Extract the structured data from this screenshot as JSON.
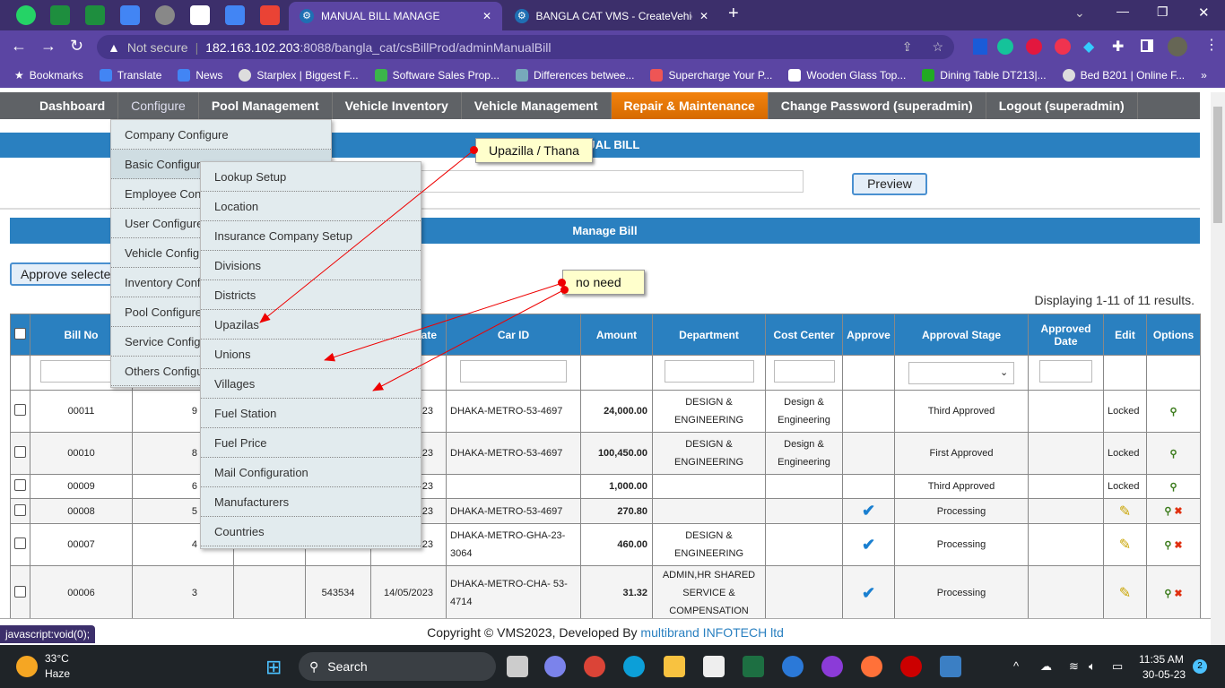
{
  "browser": {
    "tabs": [
      {
        "title": "MANUAL BILL MANAGE",
        "active": true
      },
      {
        "title": "BANGLA CAT VMS - CreateVehicl"
      }
    ],
    "security": "Not secure",
    "url_host": "182.163.102.203",
    "url_path": ":8088/bangla_cat/csBillProd/adminManualBill",
    "bookmarks": [
      "Bookmarks",
      "Translate",
      "News",
      "Starplex | Biggest F...",
      "Software Sales Prop...",
      "Differences betwee...",
      "Supercharge Your P...",
      "Wooden Glass Top...",
      "Dining Table DT213|...",
      "Bed B201 | Online F..."
    ],
    "status_url": "javascript:void(0);"
  },
  "nav": [
    "Dashboard",
    "Configure",
    "Pool Management",
    "Vehicle Inventory",
    "Vehicle Management",
    "Repair & Maintenance",
    "Change Password (superadmin)",
    "Logout (superadmin)"
  ],
  "configure_menu": [
    "Company Configure",
    "Basic Configure",
    "Employee Configure",
    "User Configure",
    "Vehicle Configure",
    "Inventory Configure",
    "Pool Configure",
    "Service Configure",
    "Others Configure"
  ],
  "basic_submenu": [
    "Lookup Setup",
    "Location",
    "Insurance Company Setup",
    "Divisions",
    "Districts",
    "Upazilas",
    "Unions",
    "Villages",
    "Fuel Station",
    "Fuel Price",
    "Mail Configuration",
    "Manufacturers",
    "Countries"
  ],
  "page": {
    "title": "MANUAL BILL",
    "preview": "Preview",
    "section": "Manage Bill",
    "approve_selected": "Approve selected",
    "displaying": "Displaying 1-11 of 11 results."
  },
  "notes": {
    "upazilla": "Upazilla / Thana",
    "no_need": "no need"
  },
  "table": {
    "headers": [
      "Bill No",
      "",
      "",
      "",
      "Date",
      "Car ID",
      "Amount",
      "Department",
      "Cost Center",
      "Approve",
      "Approval Stage",
      "Approved Date",
      "Edit",
      "Options"
    ],
    "rows": [
      {
        "bill": "00011",
        "c2": "9",
        "c4": "",
        "date": "23",
        "car": "DHAKA-METRO-53-4697",
        "amount": "24,000.00",
        "dept": "DESIGN & ENGINEERING",
        "cost": "Design & Engineering",
        "approve": false,
        "stage": "Third Approved",
        "edit": "Locked",
        "delete": false
      },
      {
        "bill": "00010",
        "c2": "8",
        "c4": "",
        "date": "23",
        "car": "DHAKA-METRO-53-4697",
        "amount": "100,450.00",
        "dept": "DESIGN & ENGINEERING",
        "cost": "Design & Engineering",
        "approve": false,
        "stage": "First Approved",
        "edit": "Locked",
        "delete": false
      },
      {
        "bill": "00009",
        "c2": "6",
        "c4": "",
        "date": "23",
        "car": "",
        "amount": "1,000.00",
        "dept": "",
        "cost": "",
        "approve": false,
        "stage": "Third Approved",
        "edit": "Locked",
        "delete": false
      },
      {
        "bill": "00008",
        "c2": "5",
        "c4": "",
        "date": "23",
        "car": "DHAKA-METRO-53-4697",
        "amount": "270.80",
        "dept": "",
        "cost": "",
        "approve": true,
        "stage": "Processing",
        "edit": "",
        "delete": true
      },
      {
        "bill": "00007",
        "c2": "4",
        "c4": "",
        "date": "23",
        "car": "DHAKA-METRO-GHA-23-3064",
        "amount": "460.00",
        "dept": "DESIGN & ENGINEERING",
        "cost": "",
        "approve": true,
        "stage": "Processing",
        "edit": "",
        "delete": true
      },
      {
        "bill": "00006",
        "c2": "3",
        "c4": "543534",
        "date": "14/05/2023",
        "car": "DHAKA-METRO-CHA- 53-4714",
        "amount": "31.32",
        "dept": "ADMIN,HR SHARED SERVICE & COMPENSATION",
        "cost": "",
        "approve": true,
        "stage": "Processing",
        "edit": "",
        "delete": true
      }
    ]
  },
  "footer": {
    "text": "Copyright © VMS2023, Developed By ",
    "link": "multibrand INFOTECH ltd"
  },
  "taskbar": {
    "temp": "33°C",
    "weather": "Haze",
    "search": "Search",
    "time": "11:35 AM",
    "date": "30-05-23",
    "notif": "2"
  },
  "colors": {
    "accent": "#2a80c0",
    "active_nav": "#e87a0a",
    "browser": "#5b45a3"
  }
}
